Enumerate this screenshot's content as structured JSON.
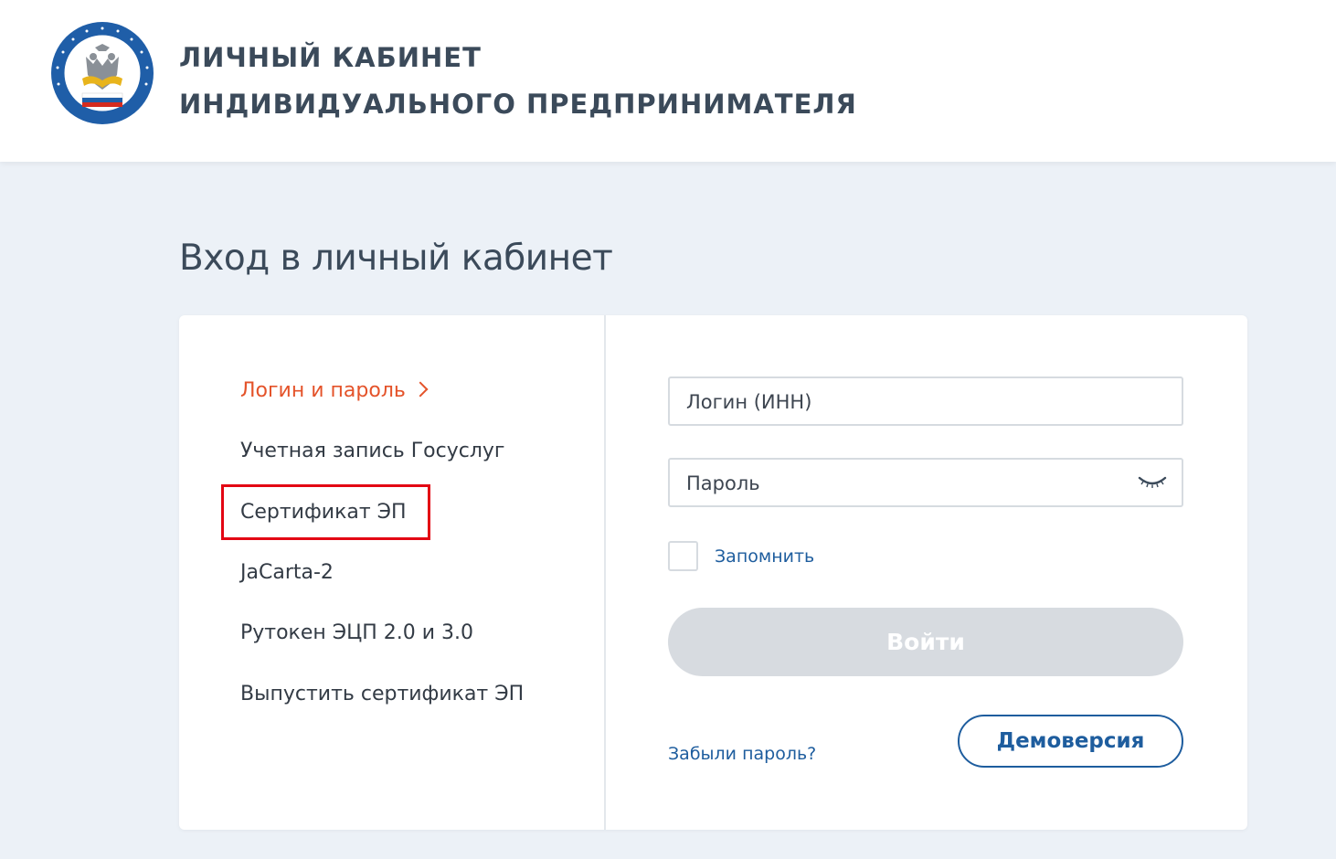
{
  "header": {
    "title_line1": "ЛИЧНЫЙ КАБИНЕТ",
    "title_line2": "ИНДИВИДУАЛЬНОГО ПРЕДПРИНИМАТЕЛЯ",
    "logo_icon": "fns-emblem-icon"
  },
  "page_title": "Вход в личный кабинет",
  "methods": [
    {
      "label": "Логин и пароль",
      "active": true
    },
    {
      "label": "Учетная запись Госуслуг",
      "active": false
    },
    {
      "label": "Сертификат ЭП",
      "active": false
    },
    {
      "label": "JaCarta-2",
      "active": false
    },
    {
      "label": "Рутокен ЭЦП 2.0 и 3.0",
      "active": false
    },
    {
      "label": "Выпустить сертификат ЭП",
      "active": false
    }
  ],
  "form": {
    "login_placeholder": "Логин (ИНН)",
    "password_placeholder": "Пароль",
    "remember_label": "Запомнить",
    "submit_label": "Войти",
    "forgot_label": "Забыли пароль?",
    "demo_label": "Демоверсия"
  },
  "colors": {
    "accent_orange": "#e4532a",
    "link_blue": "#1e5d9e",
    "highlight_red": "#e30613",
    "disabled_button": "#d7dbe0"
  }
}
